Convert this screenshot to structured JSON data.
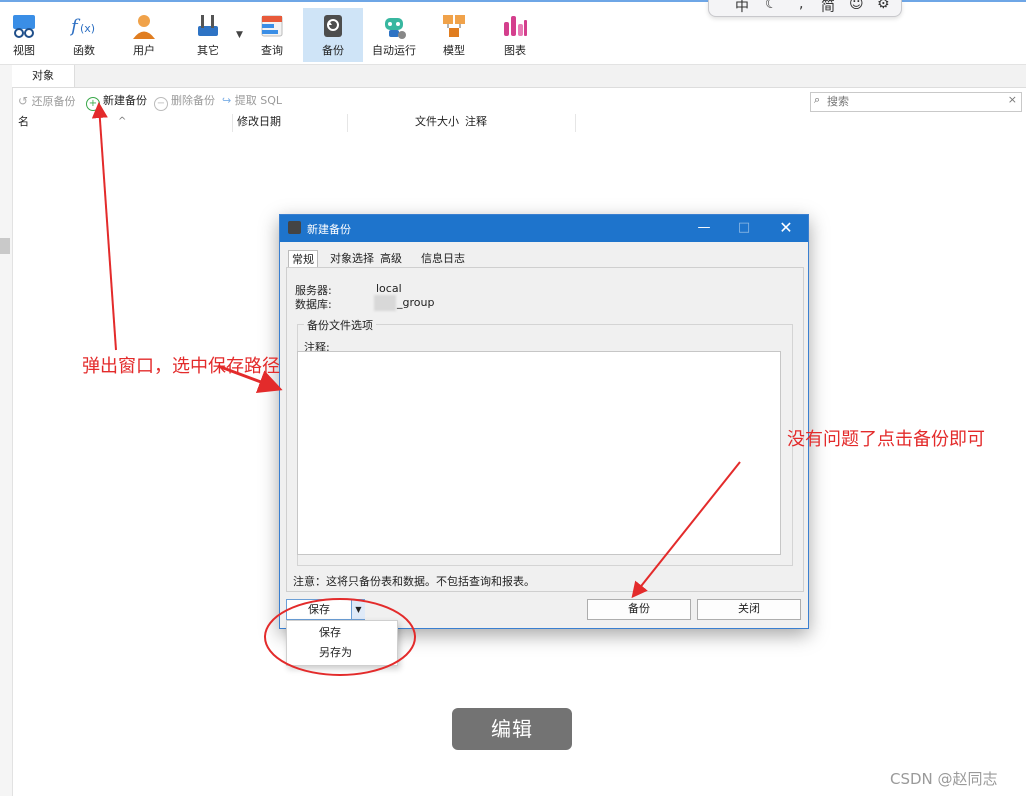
{
  "toolbar": {
    "buttons": [
      {
        "label": "视图",
        "icon": "view-icon"
      },
      {
        "label": "函数",
        "icon": "function-icon"
      },
      {
        "label": "用户",
        "icon": "user-icon"
      },
      {
        "label": "其它",
        "icon": "tools-icon"
      },
      {
        "label": "查询",
        "icon": "query-icon"
      },
      {
        "label": "备份",
        "icon": "backup-icon"
      },
      {
        "label": "自动运行",
        "icon": "robot-icon"
      },
      {
        "label": "模型",
        "icon": "model-icon"
      },
      {
        "label": "图表",
        "icon": "chart-icon"
      }
    ],
    "active": "备份"
  },
  "ime": {
    "items": [
      "中",
      "简"
    ]
  },
  "tabs": {
    "objects": "对象"
  },
  "actions": {
    "restore": "还原备份",
    "new_backup": "新建备份",
    "delete_backup": "删除备份",
    "extract_sql": "提取 SQL"
  },
  "search": {
    "placeholder": "搜索",
    "clear": "×"
  },
  "list": {
    "columns": [
      "名",
      "修改日期",
      "文件大小",
      "注释"
    ]
  },
  "dialog": {
    "title": "新建备份",
    "tabs": [
      "常规",
      "对象选择",
      "高级",
      "信息日志"
    ],
    "server_label": "服务器:",
    "server_value": "local",
    "database_label": "数据库:",
    "database_value": "_group",
    "fieldset_legend": "备份文件选项",
    "comment_label": "注释:",
    "note": "注意：这将只备份表和数据。不包括查询和报表。",
    "save_label": "保存",
    "backup_label": "备份",
    "close_label": "关闭"
  },
  "save_menu": {
    "items": [
      "保存",
      "另存为"
    ]
  },
  "annotations": {
    "left": "弹出窗口，选中保存路径",
    "right": "没有问题了点击备份即可"
  },
  "edit_button": "编辑",
  "watermark": "CSDN @赵同志",
  "colors": {
    "accent": "#1e74cc",
    "annotation": "#e32b2b"
  }
}
